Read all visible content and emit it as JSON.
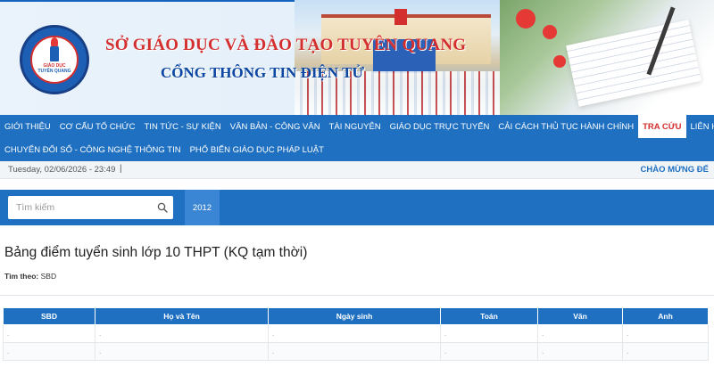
{
  "banner": {
    "org_name": "SỞ GIÁO DỤC VÀ ĐÀO TẠO TUYÊN QUANG",
    "portal_name": "CỔNG THÔNG TIN ĐIỆN TỬ",
    "logo_line1": "GIÁO DỤC",
    "logo_line2": "TUYÊN QUANG"
  },
  "nav": {
    "row1": [
      {
        "label": "GIỚI THIỆU"
      },
      {
        "label": "CƠ CẤU TỔ CHỨC"
      },
      {
        "label": "TIN TỨC - SỰ KIỆN"
      },
      {
        "label": "VĂN BẢN - CÔNG VĂN"
      },
      {
        "label": "TÀI NGUYÊN"
      },
      {
        "label": "GIÁO DỤC TRỰC TUYẾN"
      },
      {
        "label": "CẢI CÁCH THỦ TỤC HÀNH CHÍNH"
      },
      {
        "label": "TRA CỨU"
      },
      {
        "label": "LIÊN HỆ"
      }
    ],
    "row2": [
      {
        "label": "CHUYỂN ĐỔI SỐ - CÔNG NGHỆ THÔNG TIN"
      },
      {
        "label": "PHỔ BIẾN GIÁO DỤC PHÁP LUẬT"
      }
    ],
    "active": "TRA CỨU"
  },
  "datebar": {
    "date": "Tuesday, 02/06/2026 - 23:49",
    "separator": "|",
    "welcome": "CHÀO MỪNG ĐẾ"
  },
  "search": {
    "placeholder": "Tìm kiếm",
    "value": "",
    "year_tab": "2012"
  },
  "content": {
    "title": "Bảng điểm tuyển sinh lớp 10 THPT (KQ tạm thời)",
    "filter_label": "Tìm theo:",
    "filter_value": "SBD"
  },
  "table": {
    "headers": [
      "SBD",
      "Họ và Tên",
      "Ngày sinh",
      "Toán",
      "Văn",
      "Anh"
    ],
    "rows": [
      [
        ".",
        ".",
        ".",
        ".",
        ".",
        "."
      ],
      [
        ".",
        ".",
        ".",
        ".",
        ".",
        "."
      ]
    ]
  },
  "colors": {
    "nav_blue": "#1f70c1",
    "active_red": "#d32f2f",
    "org_red": "#d32f2f",
    "portal_blue": "#0d47a1"
  }
}
